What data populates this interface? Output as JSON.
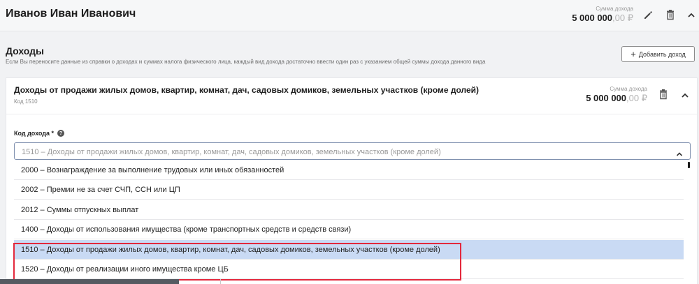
{
  "person": {
    "name": "Иванов Иван Иванович",
    "sum_label": "Сумма дохода",
    "sum_main": "5 000 000",
    "sum_decimals": ",00 ₽"
  },
  "incomes": {
    "title": "Доходы",
    "hint": "Если Вы переносите данные из справки о доходах и суммах налога физического лица, каждый вид дохода достаточно ввести один раз с указанием общей суммы дохода данного вида",
    "add_button": "Добавить доход",
    "add_icon": "+",
    "card": {
      "title": "Доходы от продажи жилых домов, квартир, комнат, дач, садовых домиков, земельных участков (кроме долей)",
      "code": "Код 1510",
      "sum_label": "Сумма дохода",
      "sum_main": "5 000 000",
      "sum_decimals": ",00 ₽",
      "field_label": "Код дохода *",
      "help_icon": "?",
      "select_value": "1510 – Доходы от продажи жилых домов, квартир, комнат, дач, садовых домиков, земельных участков (кроме долей)",
      "options": [
        "2000 – Вознаграждение за выполнение трудовых или иных обязанностей",
        "2002 – Премии не за счет СЧП, ССН или ЦП",
        "2012 – Суммы отпускных выплат",
        "1400 – Доходы от использования имущества (кроме транспортных средств и средств связи)",
        "1510 – Доходы от продажи жилых домов, квартир, комнат, дач, садовых домиков, земельных участков (кроме долей)",
        "1520 – Доходы от реализации иного имущества кроме ЦБ"
      ]
    }
  },
  "colors": {
    "selected_option": "#c9daf4",
    "highlight_border": "#e3283c",
    "select_border": "#7e8fae"
  }
}
